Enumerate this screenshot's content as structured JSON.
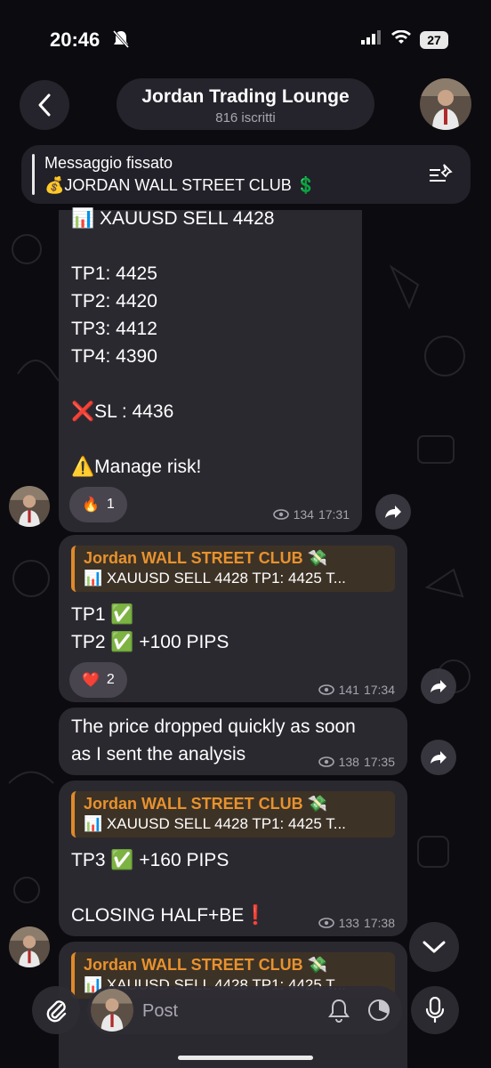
{
  "status_bar": {
    "time": "20:46",
    "battery": "27"
  },
  "header": {
    "title": "Jordan Trading Lounge",
    "subscribers": "816 iscritti"
  },
  "pinned": {
    "label": "Messaggio fissato",
    "text": "💰JORDAN WALL STREET CLUB 💲"
  },
  "messages": [
    {
      "text": "📊 XAUUSD SELL 4428\n\nTP1: 4425\nTP2: 4420\nTP3: 4412\nTP4: 4390\n\n❌SL : 4436\n\n⚠️Manage risk!",
      "reaction_emoji": "🔥",
      "reaction_count": "1",
      "views": "134",
      "time": "17:31"
    },
    {
      "reply_author": "Jordan WALL STREET CLUB 💸",
      "reply_text": "📊 XAUUSD SELL 4428 TP1: 4425 T...",
      "text": "TP1 ✅\nTP2 ✅ +100 PIPS",
      "reaction_emoji": "❤️",
      "reaction_count": "2",
      "views": "141",
      "time": "17:34"
    },
    {
      "text": "The price dropped quickly as soon\nas I sent the analysis",
      "views": "138",
      "time": "17:35"
    },
    {
      "reply_author": "Jordan WALL STREET CLUB 💸",
      "reply_text": "📊 XAUUSD SELL 4428 TP1: 4425 T...",
      "text": "TP3 ✅ +160 PIPS\n\nCLOSING HALF+BE❗",
      "views": "133",
      "time": "17:38"
    },
    {
      "reply_author": "Jordan WALL STREET CLUB 💸",
      "reply_text": "📊 XAUUSD SELL 4428 TP1: 4425 T..."
    }
  ],
  "composer": {
    "placeholder": "Post"
  },
  "colors": {
    "accent_orange": "#e8922e",
    "bubble": "#2b2930",
    "background": "#0c0b10"
  },
  "icons": [
    "bell-slash-icon",
    "signal-icon",
    "wifi-icon",
    "back-chevron-icon",
    "pin-list-icon",
    "eye-icon",
    "forward-icon",
    "chevron-down-icon",
    "paperclip-icon",
    "bell-icon",
    "timer-icon",
    "microphone-icon"
  ]
}
